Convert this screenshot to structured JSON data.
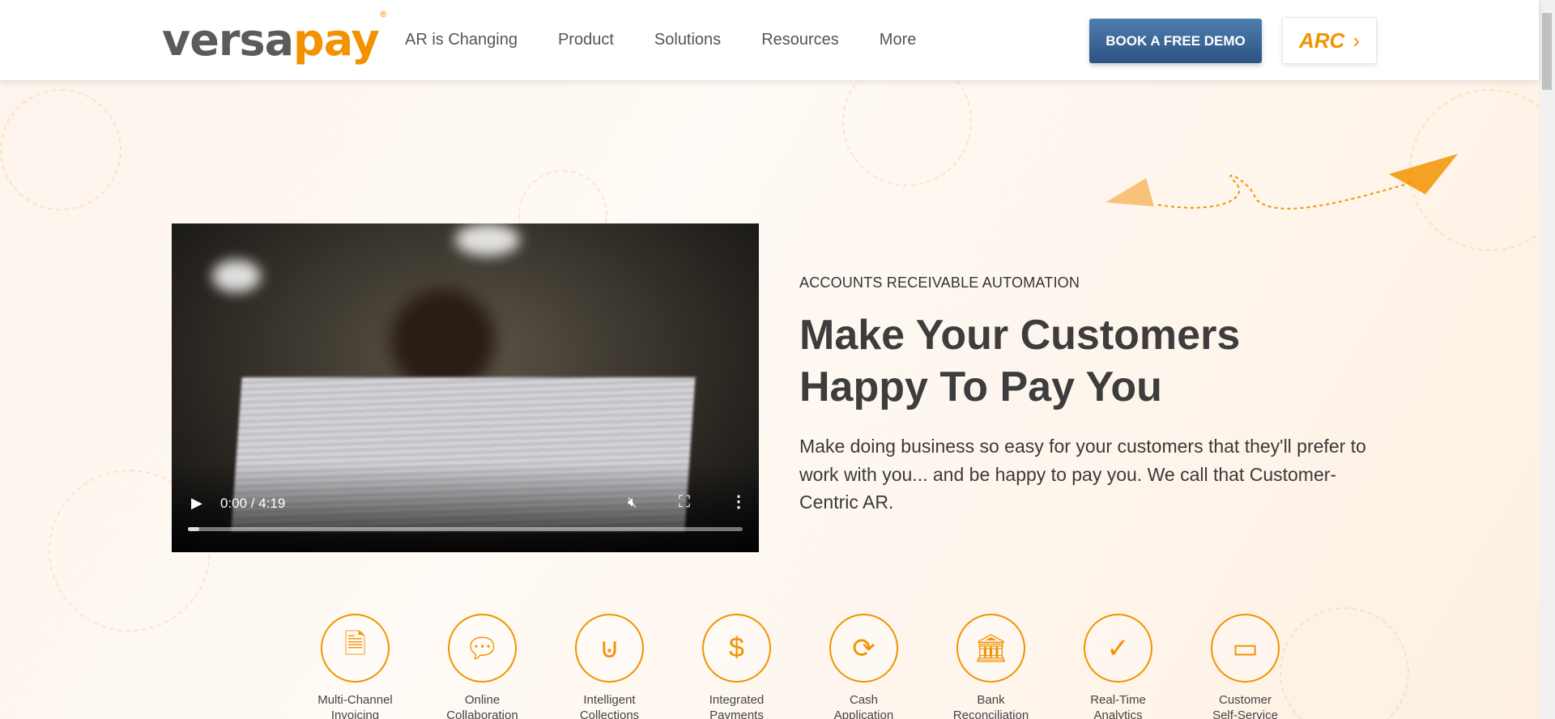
{
  "header": {
    "logo_left": "versa",
    "logo_right": "pay",
    "logo_mark": "®",
    "nav": [
      "AR is Changing",
      "Product",
      "Solutions",
      "Resources",
      "More"
    ],
    "demo_button": "BOOK A FREE DEMO",
    "arc_button": "ARC",
    "arc_arrow": "›"
  },
  "video": {
    "time": "0:00 / 4:19",
    "progress": 0.02
  },
  "hero": {
    "eyebrow": "ACCOUNTS RECEIVABLE AUTOMATION",
    "title_line1": "Make Your Customers",
    "title_line2": "Happy To Pay You",
    "description": "Make doing business so easy for your customers that they'll prefer to work with you... and be happy to pay you. We call that Customer-Centric AR."
  },
  "features": [
    {
      "line1": "Multi-Channel",
      "line2": "Invoicing",
      "icon": "invoice-icon"
    },
    {
      "line1": "Online",
      "line2": "Collaboration",
      "icon": "chat-icon"
    },
    {
      "line1": "Intelligent",
      "line2": "Collections",
      "icon": "magnet-icon"
    },
    {
      "line1": "Integrated",
      "line2": "Payments",
      "icon": "dollar-icon"
    },
    {
      "line1": "Cash",
      "line2": "Application",
      "icon": "cash-cycle-icon"
    },
    {
      "line1": "Bank",
      "line2": "Reconciliation",
      "icon": "bank-icon"
    },
    {
      "line1": "Real-Time",
      "line2": "Analytics",
      "icon": "analytics-icon"
    },
    {
      "line1": "Customer",
      "line2": "Self-Service",
      "icon": "card-icon"
    }
  ],
  "colors": {
    "brand_orange": "#f39200",
    "button_blue": "#2b5283"
  }
}
